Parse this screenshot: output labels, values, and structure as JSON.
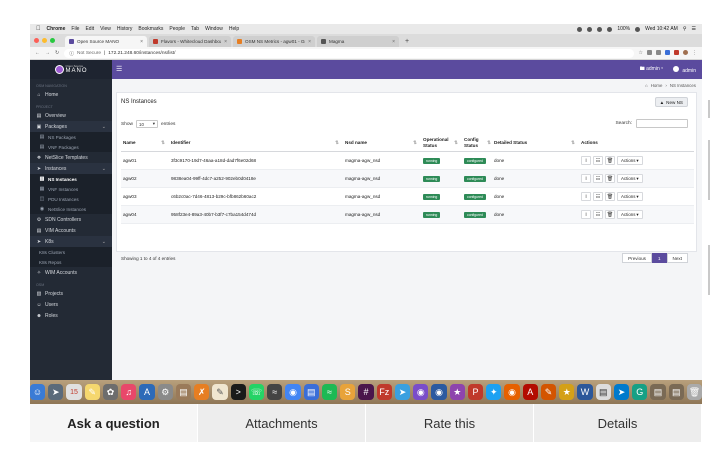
{
  "menubar": {
    "app": "Chrome",
    "items": [
      "File",
      "Edit",
      "View",
      "History",
      "Bookmarks",
      "People",
      "Tab",
      "Window",
      "Help"
    ],
    "battery": "100%",
    "clock": "Wed 10:42 AM"
  },
  "browser": {
    "tabs": [
      {
        "label": "Open Source MANO",
        "active": true,
        "color": "#5b4b9e"
      },
      {
        "label": "Flavors - Whitecloud Dashboard",
        "active": false,
        "color": "#c0392b"
      },
      {
        "label": "OSM NS Metrics - agw01 - Gra",
        "active": false,
        "color": "#e67e22"
      },
      {
        "label": "Magma",
        "active": false,
        "color": "#555555"
      }
    ],
    "address_prefix": "Not Secure",
    "address": "172.21.248.60/instances/ns/list/"
  },
  "header": {
    "logo_small": "Open Source",
    "logo_big": "MANO",
    "project": "admin",
    "user": "admin"
  },
  "sidebar": {
    "nav_heading": "OSM NAVIGATION",
    "home": "Home",
    "project_heading": "PROJECT",
    "overview": "Overview",
    "packages": "Packages",
    "ns_packages": "NS Packages",
    "vnf_packages": "VNF Packages",
    "netslice_templates": "NetSlice Templates",
    "instances": "Instances",
    "ns_instances": "NS Instances",
    "vnf_instances": "VNF Instances",
    "pdu_instances": "PDU Instances",
    "netslice_instances": "NetSlice Instances",
    "sdn_controllers": "SDN Controllers",
    "vim_accounts": "VIM Accounts",
    "k8s": "K8s",
    "k8s_clusters": "K8s Clusters",
    "k8s_repos": "K8s Repos",
    "wim_accounts": "WIM Accounts",
    "osm_heading": "OSM",
    "projects": "Projects",
    "users": "Users",
    "roles": "Roles"
  },
  "breadcrumb": {
    "home": "Home",
    "sep": "›",
    "current": "NS Instances"
  },
  "main": {
    "title": "NS Instances",
    "new_button": "New NS",
    "show_label": "Show",
    "show_value": "10",
    "entries_label": "entries",
    "search_label": "Search:",
    "columns": {
      "name": "Name",
      "identifier": "Identifier",
      "nsd": "Nsd name",
      "operational_1": "Operational",
      "operational_2": "Status",
      "config_1": "Config",
      "config_2": "Status",
      "detailed": "Detailed Status",
      "actions": "Actions"
    },
    "rows": [
      {
        "name": "agw01",
        "id": "3f3c9170-19d7-46aa-a18d-dad7f6e02d68",
        "nsd": "magma-agw_nsd",
        "op": "running",
        "cfg": "configured",
        "detail": "done",
        "actions": "Actions"
      },
      {
        "name": "agw02",
        "id": "9838ea04-99ff-4dc7-a252-902eb0d0418e",
        "nsd": "magma-agw_nsd",
        "op": "running",
        "cfg": "configured",
        "detail": "done",
        "actions": "Actions"
      },
      {
        "name": "agw03",
        "id": "c6b2c0ac-7d46-4813-b29c-bfb862b60ac2",
        "nsd": "magma-agw_nsd",
        "op": "running",
        "cfg": "configured",
        "detail": "done",
        "actions": "Actions"
      },
      {
        "name": "agw04",
        "id": "958f23e4-89a3-40b7-b3f7-c7ba154d474d",
        "nsd": "magma-agw_nsd",
        "op": "running",
        "cfg": "configured",
        "detail": "done",
        "actions": "Actions"
      }
    ],
    "showing": "Showing 1 to 4 of 4 entries",
    "pager": {
      "prev": "Previous",
      "page": "1",
      "next": "Next"
    }
  },
  "bottom_tabs": [
    "Ask a question",
    "Attachments",
    "Rate this",
    "Details"
  ],
  "colors": {
    "accent": "#5b4b9e",
    "sidebar": "#232a35",
    "badge": "#2e8b57"
  }
}
